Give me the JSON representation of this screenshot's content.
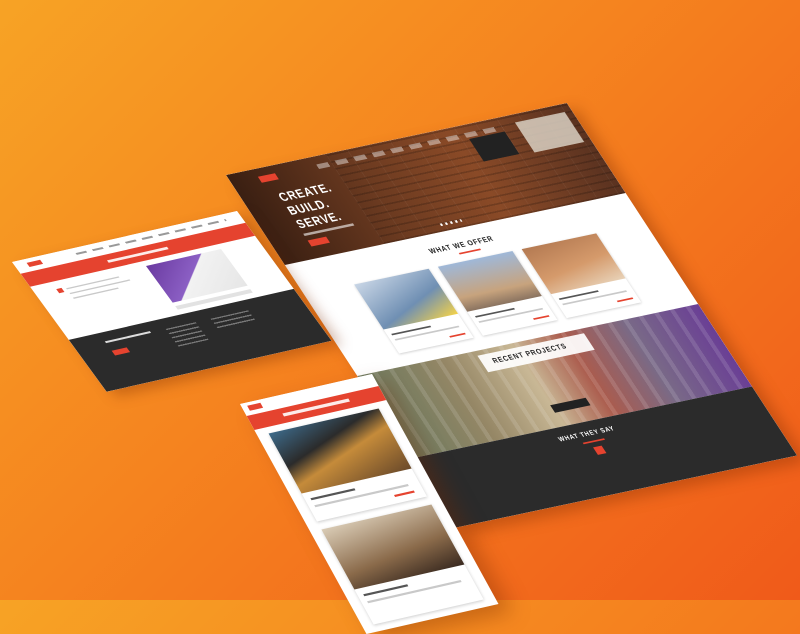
{
  "hero": {
    "line1": "CREATE.",
    "line2": "BUILD.",
    "line3": "SERVE."
  },
  "main_page": {
    "section_offer": "WHAT WE OFFER",
    "section_projects": "RECENT PROJECTS",
    "section_say": "WHAT THEY SAY"
  },
  "colors": {
    "accent": "#e5432f",
    "dark": "#2b2b2b",
    "background_start": "#f7a325",
    "background_end": "#f05a1a"
  }
}
